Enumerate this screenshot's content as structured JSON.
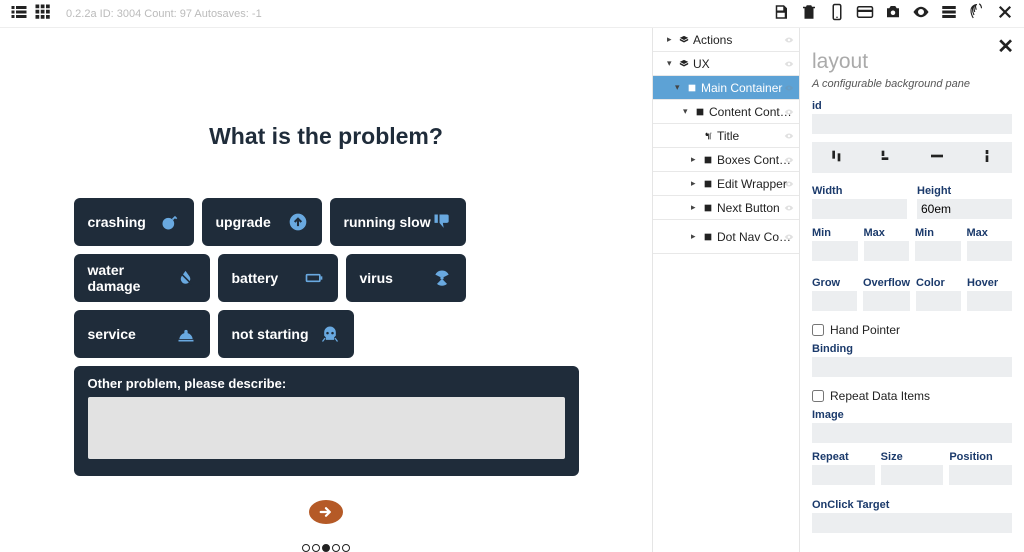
{
  "topbar": {
    "meta": "0.2.2a ID: 3004 Count: 97 Autosaves: -1"
  },
  "canvas": {
    "title": "What is the problem?",
    "boxes": [
      "crashing",
      "upgrade",
      "running slow",
      "water damage",
      "battery",
      "virus",
      "service",
      "not starting"
    ],
    "describe_label": "Other problem, please describe:",
    "dot_active_index": 2,
    "dot_count": 5
  },
  "tree": {
    "items": [
      {
        "label": "Actions",
        "depth": 1,
        "expand": "right",
        "icon": "layers"
      },
      {
        "label": "UX",
        "depth": 1,
        "expand": "down",
        "icon": "layers"
      },
      {
        "label": "Main Container",
        "depth": 2,
        "expand": "down",
        "icon": "square",
        "selected": true
      },
      {
        "label": "Content Container",
        "depth": 3,
        "expand": "down",
        "icon": "square"
      },
      {
        "label": "Title",
        "depth": 4,
        "expand": "",
        "icon": "para"
      },
      {
        "label": "Boxes Container",
        "depth": 4,
        "expand": "right",
        "icon": "square"
      },
      {
        "label": "Edit Wrapper",
        "depth": 4,
        "expand": "right",
        "icon": "square"
      },
      {
        "label": "Next Button",
        "depth": 4,
        "expand": "right",
        "icon": "square"
      },
      {
        "label": "Dot Nav Container",
        "depth": 4,
        "expand": "right",
        "icon": "square",
        "tall": true
      }
    ]
  },
  "props": {
    "header": "layout",
    "subtitle": "A configurable background pane",
    "labels": {
      "id": "id",
      "width": "Width",
      "height": "Height",
      "min1": "Min",
      "max1": "Max",
      "min2": "Min",
      "max2": "Max",
      "grow": "Grow",
      "overflow": "Overflow",
      "color": "Color",
      "hover": "Hover",
      "hand": "Hand Pointer",
      "binding": "Binding",
      "repeat_items": "Repeat Data Items",
      "image": "Image",
      "repeat": "Repeat",
      "size": "Size",
      "position": "Position",
      "onclick": "OnClick Target"
    },
    "values": {
      "height": "60em"
    }
  }
}
